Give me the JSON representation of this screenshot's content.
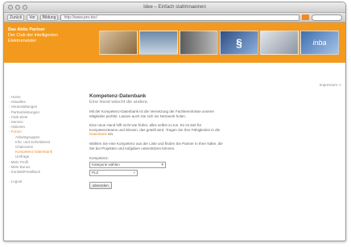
{
  "window": {
    "title": "Idee – Einfach stattmnaeinen"
  },
  "toolbar": {
    "back_label": "Zurück",
    "forward_label": "Vor",
    "bookmarks_label": "Bildung",
    "url": "http://www.pro-tec/"
  },
  "banner": {
    "brand_line1": "Das Aktiv Partner",
    "brand_line2": "Der Club der intelligenten",
    "brand_line3": "Elektromeister",
    "photo4_glyph": "§",
    "photo6_text": "inba"
  },
  "topright": {
    "link": "Impressum  ›I"
  },
  "sidebar": {
    "items": [
      {
        "label": "Home"
      },
      {
        "label": "Aktuelles"
      },
      {
        "label": "Veranstaltungen"
      },
      {
        "label": "Partnerleistungen"
      },
      {
        "label": "Club-Ziele"
      },
      {
        "label": "Service"
      },
      {
        "label": "Aktionen"
      },
      {
        "label": "Forum"
      }
    ],
    "subitems": [
      {
        "label": "Arbeitsgruppen"
      },
      {
        "label": "Info- und Sofortdienst"
      },
      {
        "label": "Chatrooms"
      },
      {
        "label": "Kompetenz-Datenbank"
      },
      {
        "label": "Umfrage"
      }
    ],
    "items_after": [
      {
        "label": "Mein Profil"
      },
      {
        "label": "Mein Bonus"
      },
      {
        "label": "Kontakt/Feedback"
      }
    ],
    "logout": "Logout"
  },
  "main": {
    "title": "Kompetenz-Datenbank",
    "subtitle": "Eine Hand wäscht die andere.",
    "para1": "Mit der Kompetenz-Datenbank ist die Vernetzung der Fachkenntnisse unserer Mitglieder perfekt. Lassen auch Sie sich ins Netzwerk holen.",
    "para2_a": "Eine neue Hand hilft nicht wie früher, alles selbst zu tun. Es ist Zeit für Kompetenzteams und Wissen, das geteilt wird. Tragen Sie Ihre Fähigkeiten in die ",
    "para2_link": "Datenbank",
    "para2_b": " ein.",
    "para3": "Wählen Sie eine Kompetenz aus der Liste und finden Sie Partner in Ihrer Nähe, die Sie bei Projekten und Aufgaben unterstützen können.",
    "select_label": "Kompetenz:",
    "select_value": "Kategorie wählen",
    "input_value": "PLZ",
    "submit_label": "absenden"
  }
}
